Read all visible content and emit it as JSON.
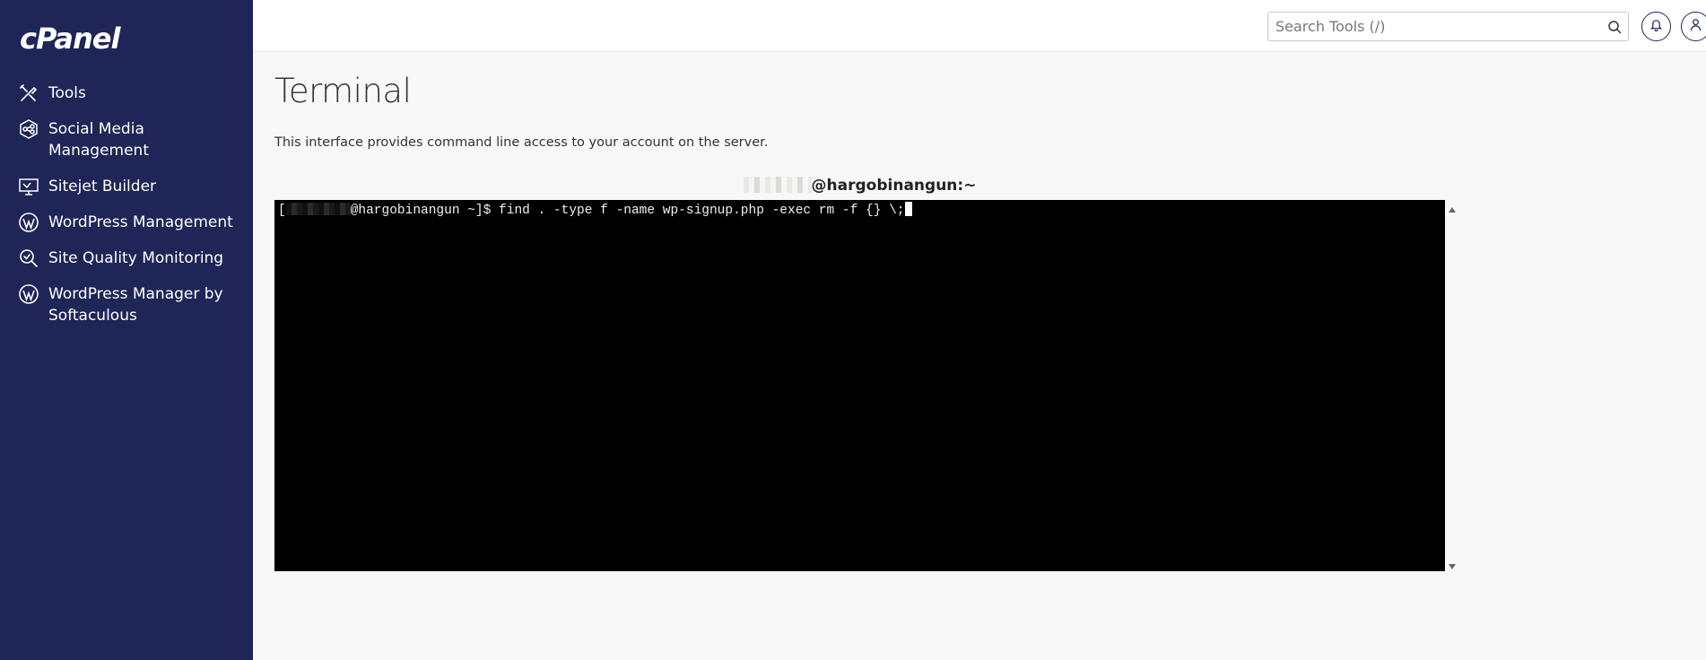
{
  "brand": {
    "logo_text": "cPanel"
  },
  "sidebar": {
    "items": [
      {
        "label": "Tools",
        "icon": "tools-icon"
      },
      {
        "label": "Social Media Management",
        "icon": "social-media-icon"
      },
      {
        "label": "Sitejet Builder",
        "icon": "sitejet-icon"
      },
      {
        "label": "WordPress Management",
        "icon": "wordpress-icon"
      },
      {
        "label": "Site Quality Monitoring",
        "icon": "site-quality-icon"
      },
      {
        "label": "WordPress Manager by Softaculous",
        "icon": "wordpress-icon"
      }
    ]
  },
  "header": {
    "search_placeholder": "Search Tools (/)",
    "notifications_icon": "bell-icon",
    "user_icon": "user-icon"
  },
  "page": {
    "title": "Terminal",
    "description": "This interface provides command line access to your account on the server."
  },
  "terminal": {
    "host_label": "@hargobinangun:~",
    "prompt_host": "@hargobinangun ~]$",
    "command": "find . -type f -name wp-signup.php -exec rm -f {} \\;"
  },
  "colors": {
    "sidebar_bg": "#1f2556",
    "terminal_bg": "#000000",
    "accent": "#1f2556"
  }
}
